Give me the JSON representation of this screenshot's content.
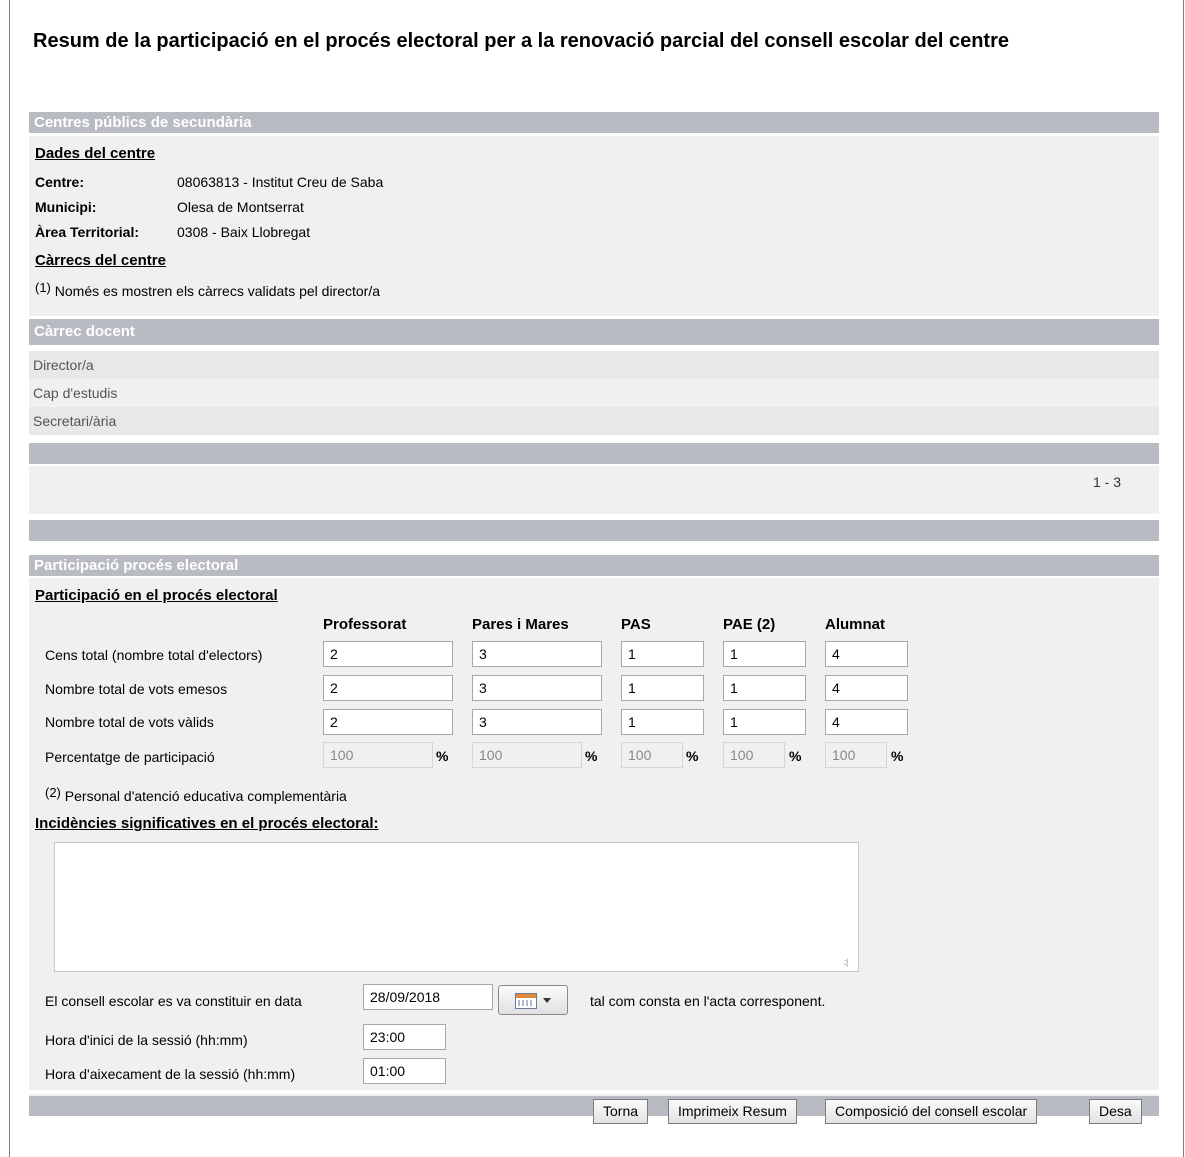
{
  "title": "Resum de la participació en el procés electoral per a la renovació parcial del consell escolar del centre",
  "centre_section": {
    "bar_title": "Centres públics de secundària",
    "data_heading": "Dades del centre",
    "centre_label": "Centre:",
    "centre_value": "08063813 - Institut Creu de Saba",
    "municipi_label": "Municipi:",
    "municipi_value": "Olesa de Montserrat",
    "area_label": "Àrea Territorial:",
    "area_value": "0308 - Baix Llobregat",
    "carrecs_heading": "Càrrecs del centre",
    "note_sup": "(1)",
    "note_text": "Només es mostren els càrrecs validats pel director/a"
  },
  "carrecs_table": {
    "header": "Càrrec docent",
    "rows": [
      "Director/a",
      "Cap d'estudis",
      "Secretari/ària"
    ],
    "pagination": "1 - 3"
  },
  "participacio": {
    "bar_title": "Participació procés electoral",
    "heading": "Participació en el procés electoral",
    "columns": [
      "Professorat",
      "Pares i Mares",
      "PAS",
      "PAE (2)",
      "Alumnat"
    ],
    "rows": [
      {
        "label": "Cens total (nombre total d'electors)",
        "values": [
          "2",
          "3",
          "1",
          "1",
          "4"
        ]
      },
      {
        "label": "Nombre total de vots emesos",
        "values": [
          "2",
          "3",
          "1",
          "1",
          "4"
        ]
      },
      {
        "label": "Nombre total de vots vàlids",
        "values": [
          "2",
          "3",
          "1",
          "1",
          "4"
        ]
      },
      {
        "label": "Percentatge de participació",
        "values": [
          "100",
          "100",
          "100",
          "100",
          "100"
        ]
      }
    ],
    "percent_sign": "%",
    "note_sup": "(2)",
    "note_text": "Personal d'atenció educativa complementària",
    "incidencies_heading": "Incidències significatives en el procés electoral:",
    "incidencies_value": "",
    "constitucio_label": "El consell escolar es va constituir en data",
    "constitucio_date": "28/09/2018",
    "constitucio_suffix": "tal com consta en l'acta corresponent.",
    "hora_inici_label": "Hora d'inici de la sessió (hh:mm)",
    "hora_inici_value": "23:00",
    "hora_aixecament_label": "Hora d'aixecament de la sessió (hh:mm)",
    "hora_aixecament_value": "01:00"
  },
  "buttons": {
    "torna": "Torna",
    "imprimeix": "Imprimeix Resum",
    "composicio": "Composició del consell escolar",
    "desa": "Desa"
  },
  "icons": {
    "calendar": "calendar-icon"
  }
}
